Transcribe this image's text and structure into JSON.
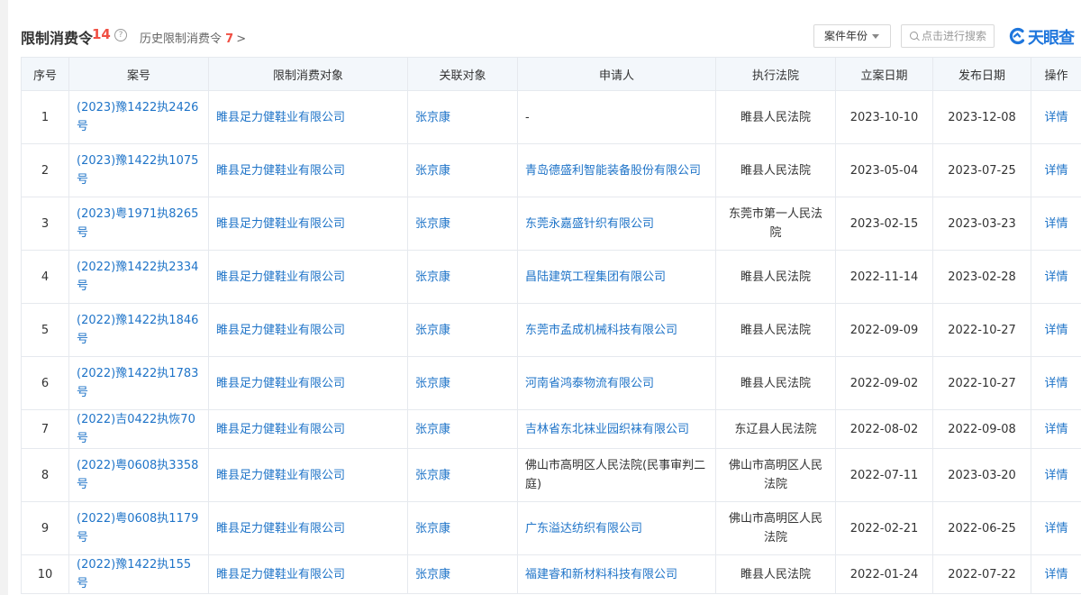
{
  "header": {
    "title": "限制消费令",
    "count": "14",
    "help_icon": "?",
    "history_label": "历史限制消费令",
    "history_count": "7",
    "history_chevron": ">",
    "year_select": "案件年份",
    "search_placeholder": "点击进行搜索",
    "logo_text": "天眼查"
  },
  "colors": {
    "link": "#1f74c8",
    "count_red": "#f04f43",
    "header_bg": "#f3f7fb",
    "border": "#e6e9ee",
    "logo_blue": "#1f76dc"
  },
  "table": {
    "columns": [
      "序号",
      "案号",
      "限制消费对象",
      "关联对象",
      "申请人",
      "执行法院",
      "立案日期",
      "发布日期",
      "操作"
    ],
    "rows": [
      {
        "no": "1",
        "case": "(2023)豫1422执2426号",
        "target": "睢县足力健鞋业有限公司",
        "related": "张京康",
        "applicant": "-",
        "court": "睢县人民法院",
        "filed": "2023-10-10",
        "published": "2023-12-08",
        "action": "详情"
      },
      {
        "no": "2",
        "case": "(2023)豫1422执1075号",
        "target": "睢县足力健鞋业有限公司",
        "related": "张京康",
        "applicant": "青岛德盛利智能装备股份有限公司",
        "court": "睢县人民法院",
        "filed": "2023-05-04",
        "published": "2023-07-25",
        "action": "详情"
      },
      {
        "no": "3",
        "case": "(2023)粤1971执8265号",
        "target": "睢县足力健鞋业有限公司",
        "related": "张京康",
        "applicant": "东莞永嘉盛针织有限公司",
        "court": "东莞市第一人民法院",
        "filed": "2023-02-15",
        "published": "2023-03-23",
        "action": "详情"
      },
      {
        "no": "4",
        "case": "(2022)豫1422执2334号",
        "target": "睢县足力健鞋业有限公司",
        "related": "张京康",
        "applicant": "昌陆建筑工程集团有限公司",
        "court": "睢县人民法院",
        "filed": "2022-11-14",
        "published": "2023-02-28",
        "action": "详情"
      },
      {
        "no": "5",
        "case": "(2022)豫1422执1846号",
        "target": "睢县足力健鞋业有限公司",
        "related": "张京康",
        "applicant": "东莞市孟成机械科技有限公司",
        "court": "睢县人民法院",
        "filed": "2022-09-09",
        "published": "2022-10-27",
        "action": "详情"
      },
      {
        "no": "6",
        "case": "(2022)豫1422执1783号",
        "target": "睢县足力健鞋业有限公司",
        "related": "张京康",
        "applicant": "河南省鸿泰物流有限公司",
        "court": "睢县人民法院",
        "filed": "2022-09-02",
        "published": "2022-10-27",
        "action": "详情"
      },
      {
        "no": "7",
        "case": "(2022)吉0422执恢70号",
        "target": "睢县足力健鞋业有限公司",
        "related": "张京康",
        "applicant": "吉林省东北袜业园织袜有限公司",
        "court": "东辽县人民法院",
        "filed": "2022-08-02",
        "published": "2022-09-08",
        "action": "详情"
      },
      {
        "no": "8",
        "case": "(2022)粤0608执3358号",
        "target": "睢县足力健鞋业有限公司",
        "related": "张京康",
        "applicant": "佛山市高明区人民法院(民事审判二庭)",
        "court": "佛山市高明区人民法院",
        "filed": "2022-07-11",
        "published": "2023-03-20",
        "action": "详情"
      },
      {
        "no": "9",
        "case": "(2022)粤0608执1179号",
        "target": "睢县足力健鞋业有限公司",
        "related": "张京康",
        "applicant": "广东溢达纺织有限公司",
        "court": "佛山市高明区人民法院",
        "filed": "2022-02-21",
        "published": "2022-06-25",
        "action": "详情"
      },
      {
        "no": "10",
        "case": "(2022)豫1422执155号",
        "target": "睢县足力健鞋业有限公司",
        "related": "张京康",
        "applicant": "福建睿和新材料科技有限公司",
        "court": "睢县人民法院",
        "filed": "2022-01-24",
        "published": "2022-07-22",
        "action": "详情"
      }
    ]
  }
}
